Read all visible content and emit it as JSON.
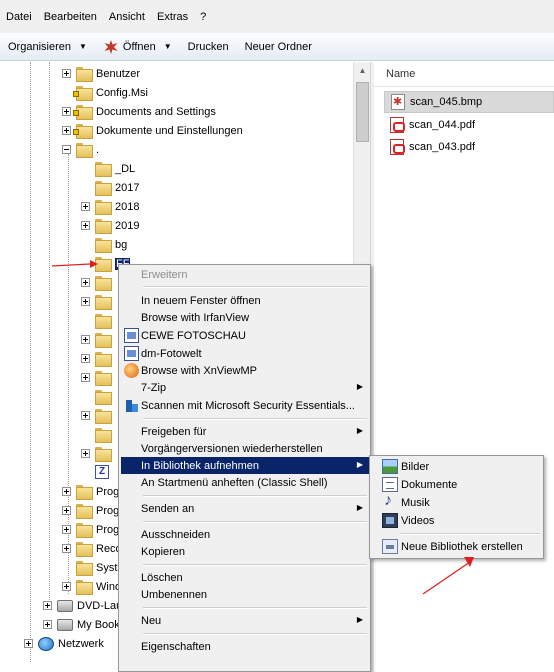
{
  "menubar": {
    "items": [
      "Datei",
      "Bearbeiten",
      "Ansicht",
      "Extras",
      "?"
    ]
  },
  "toolbar": {
    "organize_label": "Organisieren",
    "open_label": "Öffnen",
    "print_label": "Drucken",
    "new_folder_label": "Neuer Ordner"
  },
  "tree": {
    "items": [
      {
        "label": "Benutzer"
      },
      {
        "label": "Config.Msi"
      },
      {
        "label": "Documents and Settings"
      },
      {
        "label": "Dokumente und Einstellungen"
      },
      {
        "label": "."
      },
      {
        "label": "_DL"
      },
      {
        "label": "2017"
      },
      {
        "label": "2018"
      },
      {
        "label": "2019"
      },
      {
        "label": "bg"
      },
      {
        "label": "FF"
      },
      {
        "label": "Prog"
      },
      {
        "label": "Prog"
      },
      {
        "label": "Prog"
      },
      {
        "label": "Reco"
      },
      {
        "label": "Syst"
      },
      {
        "label": "Wind"
      },
      {
        "label": "DVD-Lau"
      },
      {
        "label": "My Book"
      },
      {
        "label": "Netzwerk"
      }
    ]
  },
  "filepane": {
    "column_name": "Name",
    "files": [
      {
        "name": "scan_045.bmp",
        "type": "bmp"
      },
      {
        "name": "scan_044.pdf",
        "type": "pdf"
      },
      {
        "name": "scan_043.pdf",
        "type": "pdf"
      }
    ]
  },
  "context_menu": {
    "items": [
      {
        "label": "Erweitern"
      },
      {
        "label": "In neuem Fenster öffnen"
      },
      {
        "label": "Browse with IrfanView"
      },
      {
        "label": "CEWE FOTOSCHAU"
      },
      {
        "label": "dm-Fotowelt"
      },
      {
        "label": "Browse with XnViewMP"
      },
      {
        "label": "7-Zip"
      },
      {
        "label": "Scannen mit Microsoft Security Essentials..."
      },
      {
        "label": "Freigeben für"
      },
      {
        "label": "Vorgängerversionen wiederherstellen"
      },
      {
        "label": "In Bibliothek aufnehmen"
      },
      {
        "label": "An Startmenü anheften (Classic Shell)"
      },
      {
        "label": "Senden an"
      },
      {
        "label": "Ausschneiden"
      },
      {
        "label": "Kopieren"
      },
      {
        "label": "Löschen"
      },
      {
        "label": "Umbenennen"
      },
      {
        "label": "Neu"
      },
      {
        "label": "Eigenschaften"
      }
    ]
  },
  "submenu": {
    "items": [
      {
        "label": "Bilder"
      },
      {
        "label": "Dokumente"
      },
      {
        "label": "Musik"
      },
      {
        "label": "Videos"
      },
      {
        "label": "Neue Bibliothek erstellen"
      }
    ]
  },
  "colors": {
    "highlight": "#0a246a",
    "annotation_arrow": "#e02020"
  }
}
